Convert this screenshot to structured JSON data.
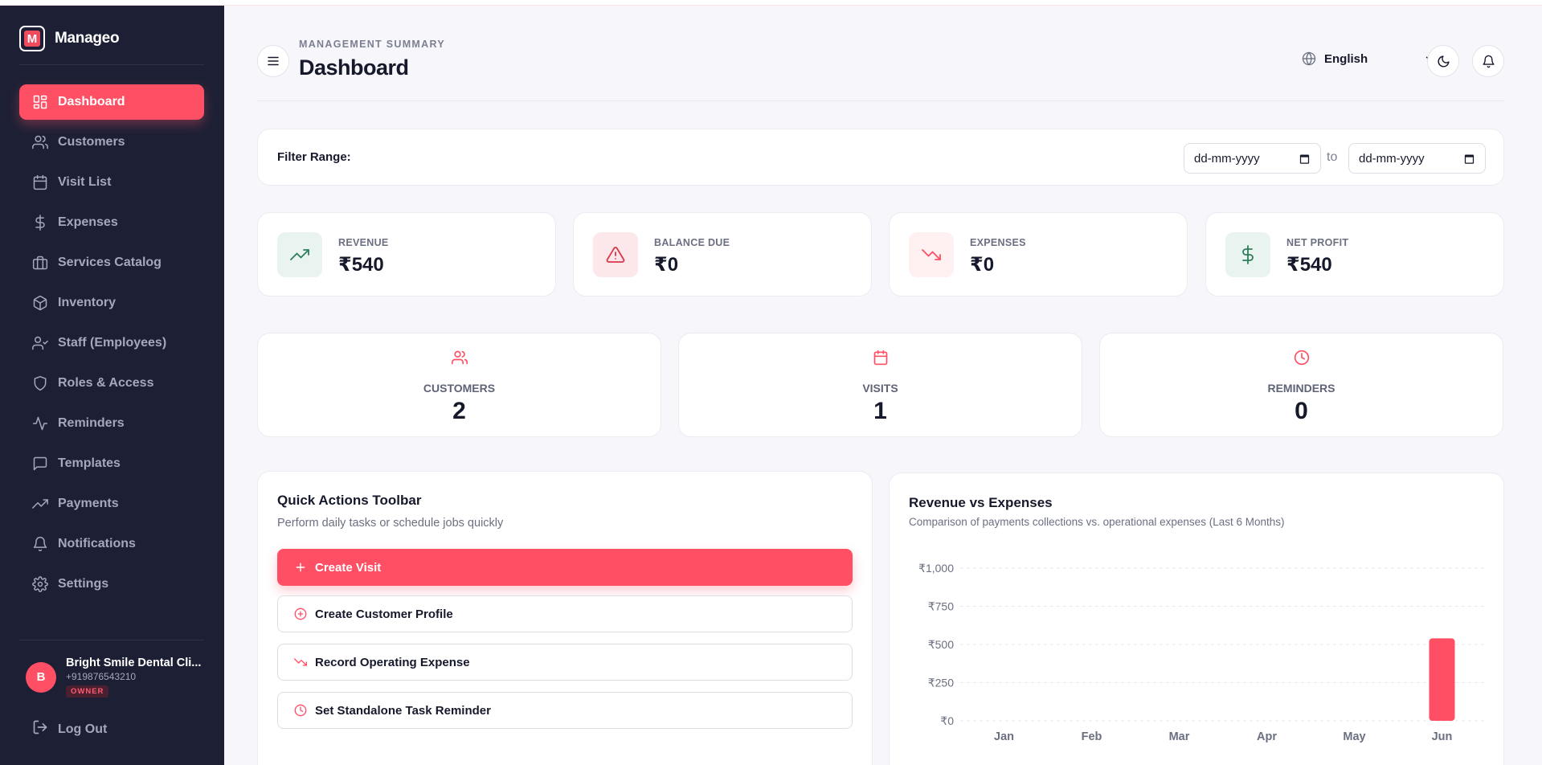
{
  "sidebar": {
    "brand": "Manageo",
    "items": [
      {
        "label": "Dashboard",
        "icon": "grid-icon",
        "active": true
      },
      {
        "label": "Customers",
        "icon": "users-icon"
      },
      {
        "label": "Visit List",
        "icon": "calendar-icon"
      },
      {
        "label": "Expenses",
        "icon": "dollar-icon"
      },
      {
        "label": "Services Catalog",
        "icon": "briefcase-icon"
      },
      {
        "label": "Inventory",
        "icon": "box-icon"
      },
      {
        "label": "Staff (Employees)",
        "icon": "user-check-icon"
      },
      {
        "label": "Roles & Access",
        "icon": "shield-icon"
      },
      {
        "label": "Reminders",
        "icon": "activity-icon"
      },
      {
        "label": "Templates",
        "icon": "message-square-icon"
      },
      {
        "label": "Payments",
        "icon": "trending-up-icon"
      },
      {
        "label": "Notifications",
        "icon": "bell-icon"
      },
      {
        "label": "Settings",
        "icon": "gear-icon"
      }
    ],
    "user": {
      "initial": "B",
      "name": "Bright Smile Dental Cli...",
      "phone": "+919876543210",
      "role": "OWNER"
    },
    "logout": "Log Out"
  },
  "header": {
    "eyebrow": "MANAGEMENT SUMMARY",
    "title": "Dashboard",
    "language": "English"
  },
  "filter": {
    "label": "Filter Range:",
    "from_placeholder": "dd-mm-yyyy",
    "to_label": "to",
    "to_placeholder": "dd-mm-yyyy"
  },
  "stats": [
    {
      "label": "REVENUE",
      "value": "₹540",
      "icon": "trending-up-icon",
      "color": "#2e7d5b",
      "bg": "#e9f3ef"
    },
    {
      "label": "BALANCE DUE",
      "value": "₹0",
      "icon": "alert-triangle-icon",
      "color": "#d9364b",
      "bg": "#fce8eb"
    },
    {
      "label": "EXPENSES",
      "value": "₹0",
      "icon": "trending-down-icon",
      "color": "#ff4f64",
      "bg": "#fff0f2"
    },
    {
      "label": "NET PROFIT",
      "value": "₹540",
      "icon": "dollar-icon",
      "color": "#2e7d5b",
      "bg": "#e9f3ef"
    }
  ],
  "counts": [
    {
      "label": "CUSTOMERS",
      "value": "2",
      "icon": "users-icon"
    },
    {
      "label": "VISITS",
      "value": "1",
      "icon": "calendar-icon"
    },
    {
      "label": "REMINDERS",
      "value": "0",
      "icon": "clock-icon"
    }
  ],
  "quick_actions": {
    "title": "Quick Actions Toolbar",
    "subtitle": "Perform daily tasks or schedule jobs quickly",
    "buttons": [
      {
        "label": "Create Visit",
        "icon": "plus-icon"
      },
      {
        "label": "Create Customer Profile",
        "icon": "plus-circle-icon"
      },
      {
        "label": "Record Operating Expense",
        "icon": "trending-down-icon"
      },
      {
        "label": "Set Standalone Task Reminder",
        "icon": "clock-icon"
      }
    ]
  },
  "revenue_chart": {
    "title": "Revenue vs Expenses",
    "subtitle": "Comparison of payments collections vs. operational expenses (Last 6 Months)"
  },
  "chart_data": {
    "type": "bar",
    "categories": [
      "Jan",
      "Feb",
      "Mar",
      "Apr",
      "May",
      "Jun"
    ],
    "series": [
      {
        "values": [
          0,
          0,
          0,
          0,
          0,
          540
        ],
        "color": "#ff4f64"
      },
      {
        "values": [
          0,
          0,
          0,
          0,
          0,
          0
        ],
        "color": "#1d2035"
      }
    ],
    "yticks": [
      "₹0",
      "₹250",
      "₹500",
      "₹750",
      "₹1,000"
    ],
    "ylim": [
      0,
      1000
    ],
    "grid": true
  },
  "colors": {
    "accent": "#ff4f64",
    "sidebar": "#1d2035"
  }
}
